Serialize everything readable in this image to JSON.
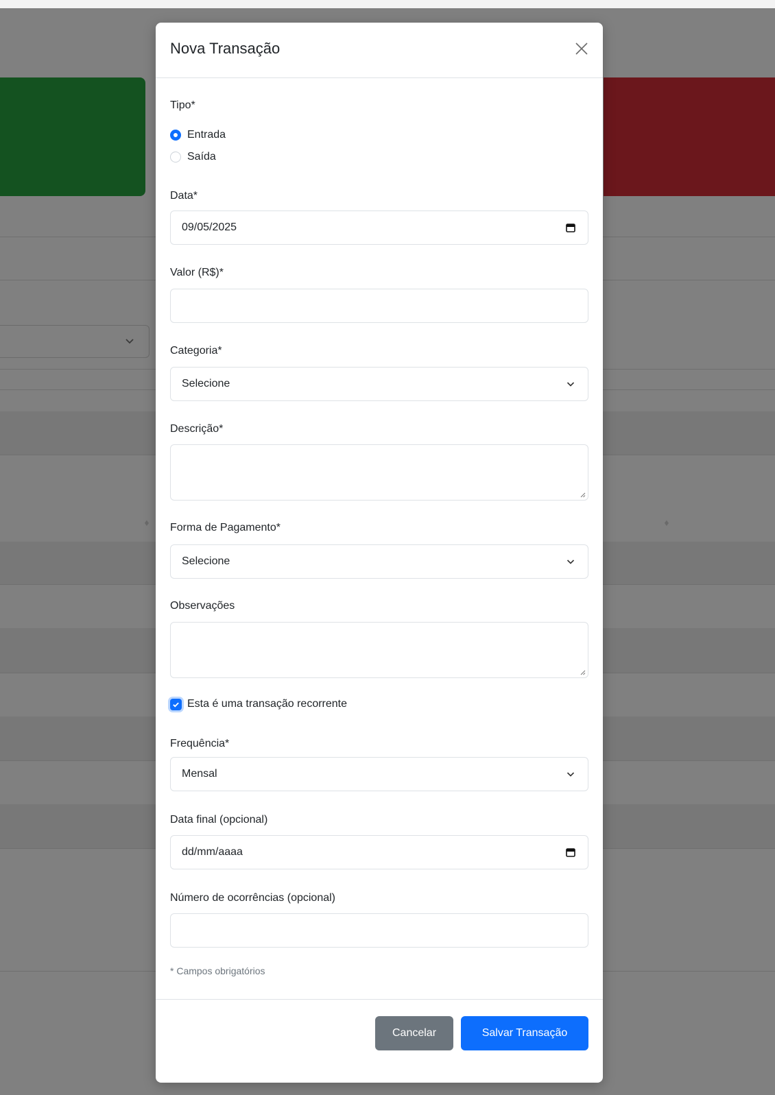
{
  "modal": {
    "title": "Nova Transação",
    "tipo": {
      "label": "Tipo*",
      "options": [
        "Entrada",
        "Saída"
      ],
      "selected": "Entrada"
    },
    "data": {
      "label": "Data*",
      "value": "09/05/2025"
    },
    "valor": {
      "label": "Valor (R$)*",
      "value": ""
    },
    "categoria": {
      "label": "Categoria*",
      "value": "Selecione"
    },
    "descricao": {
      "label": "Descrição*",
      "value": ""
    },
    "forma_pagamento": {
      "label": "Forma de Pagamento*",
      "value": "Selecione"
    },
    "observacoes": {
      "label": "Observações",
      "value": ""
    },
    "recorrente": {
      "label": "Esta é uma transação recorrente",
      "checked": true
    },
    "frequencia": {
      "label": "Frequência*",
      "value": "Mensal"
    },
    "data_final": {
      "label": "Data final (opcional)",
      "placeholder": "dd/mm/aaaa"
    },
    "ocorrencias": {
      "label": "Número de ocorrências (opcional)",
      "value": ""
    },
    "required_note": "* Campos obrigatórios",
    "buttons": {
      "cancel": "Cancelar",
      "save": "Salvar Transação"
    }
  },
  "icons": {
    "close": "close-icon",
    "calendar": "calendar-icon",
    "chevron": "chevron-down-icon",
    "checkmark": "checkmark-icon",
    "resize": "resize-grip-icon",
    "sort": "sort-icon"
  },
  "colors": {
    "primary": "#0d6efd",
    "secondary": "#6c757d",
    "income_card": "#145220",
    "expense_card": "#6b171c"
  }
}
